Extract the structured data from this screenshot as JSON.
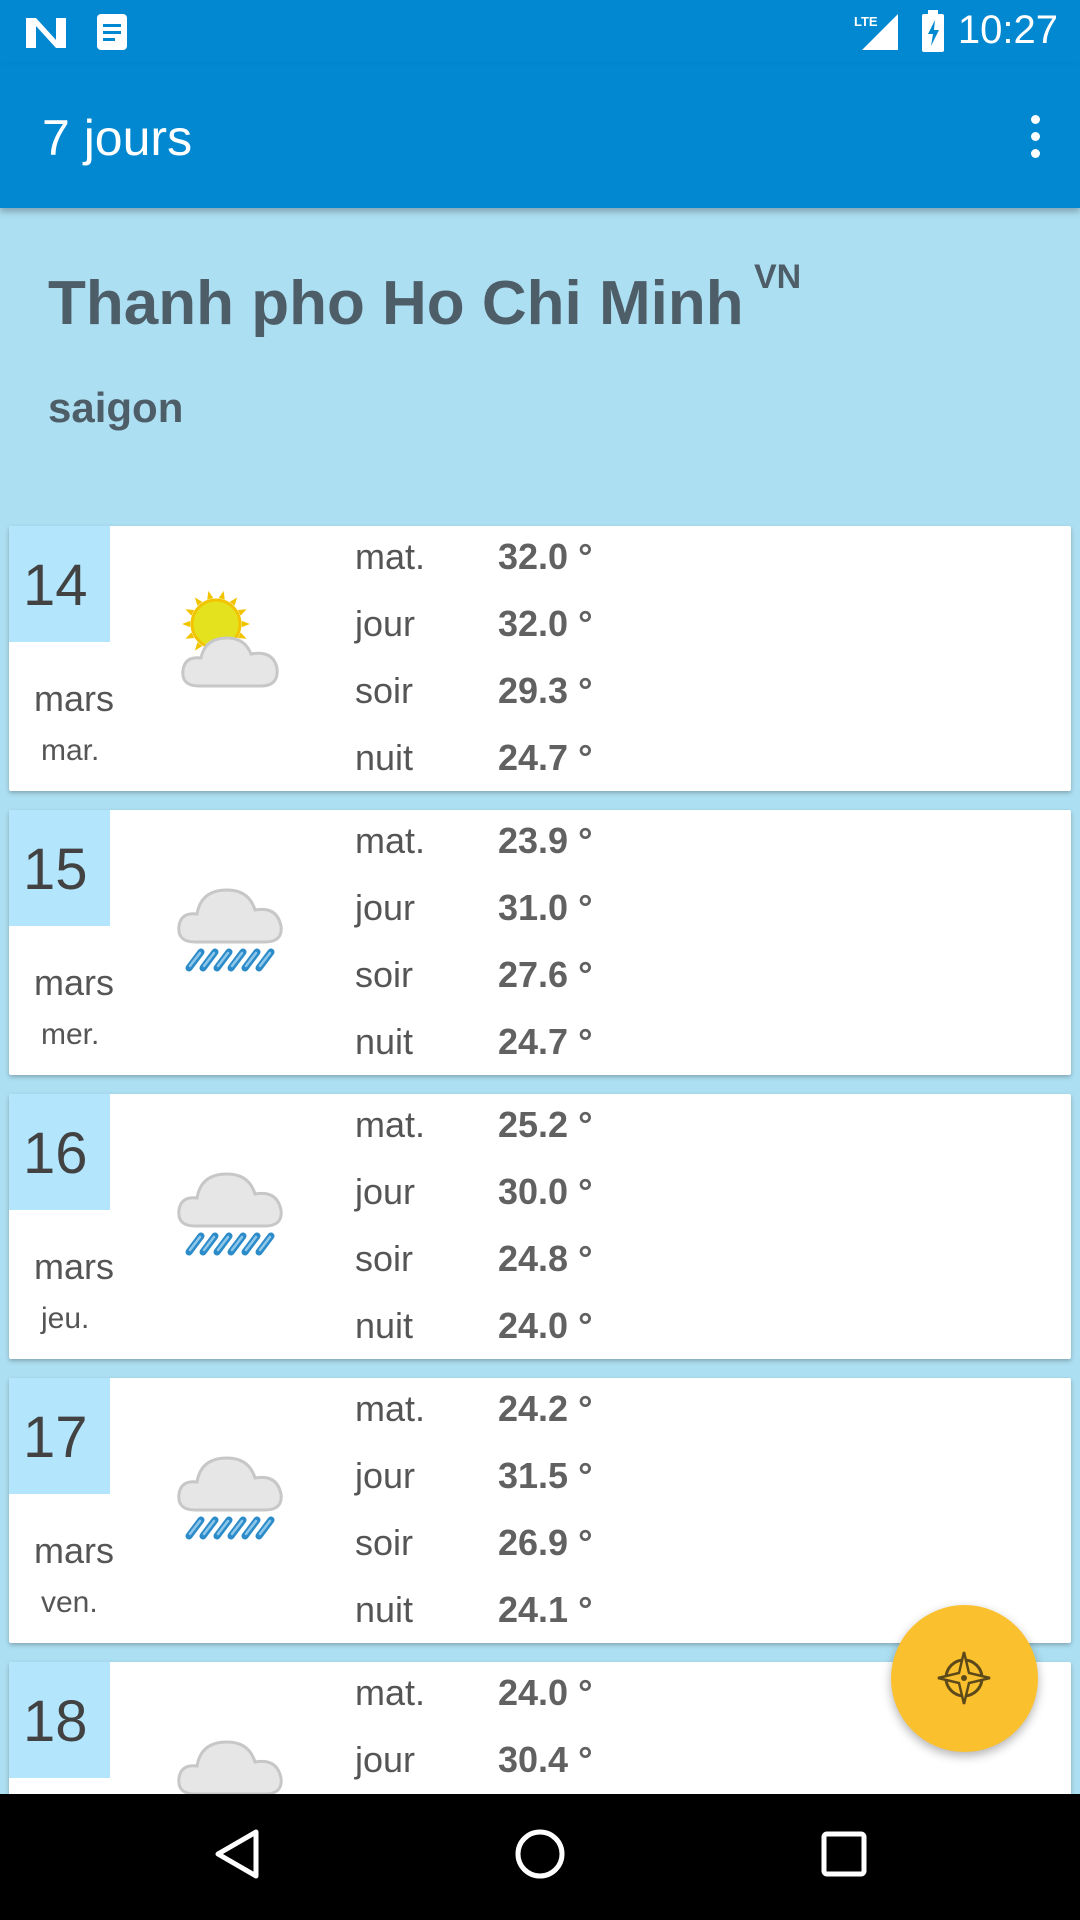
{
  "status": {
    "time": "10:27",
    "network": "LTE"
  },
  "appbar": {
    "title": "7 jours"
  },
  "header": {
    "city": "Thanh pho Ho Chi Minh",
    "country": "VN",
    "alias": "saigon"
  },
  "labels": {
    "morning": "mat.",
    "day": "jour",
    "evening": "soir",
    "night": "nuit"
  },
  "days": [
    {
      "day": "14",
      "month": "mars",
      "weekday": "mar.",
      "icon": "sun-cloud-icon",
      "temps": {
        "morning": "32.0 °",
        "day": "32.0 °",
        "evening": "29.3 °",
        "night": "24.7 °"
      }
    },
    {
      "day": "15",
      "month": "mars",
      "weekday": "mer.",
      "icon": "rain-icon",
      "temps": {
        "morning": "23.9 °",
        "day": "31.0 °",
        "evening": "27.6 °",
        "night": "24.7 °"
      }
    },
    {
      "day": "16",
      "month": "mars",
      "weekday": "jeu.",
      "icon": "rain-icon",
      "temps": {
        "morning": "25.2 °",
        "day": "30.0 °",
        "evening": "24.8 °",
        "night": "24.0 °"
      }
    },
    {
      "day": "17",
      "month": "mars",
      "weekday": "ven.",
      "icon": "rain-icon",
      "temps": {
        "morning": "24.2 °",
        "day": "31.5 °",
        "evening": "26.9 °",
        "night": "24.1 °"
      }
    },
    {
      "day": "18",
      "month": "",
      "weekday": "",
      "icon": "cloud-icon",
      "temps": {
        "morning": "24.0 °",
        "day": "30.4 °",
        "evening": "",
        "night": ""
      }
    }
  ],
  "fab": {
    "icon": "compass-icon"
  },
  "colors": {
    "primary": "#0288d1",
    "background": "#addff2",
    "fab": "#fbc02d"
  }
}
